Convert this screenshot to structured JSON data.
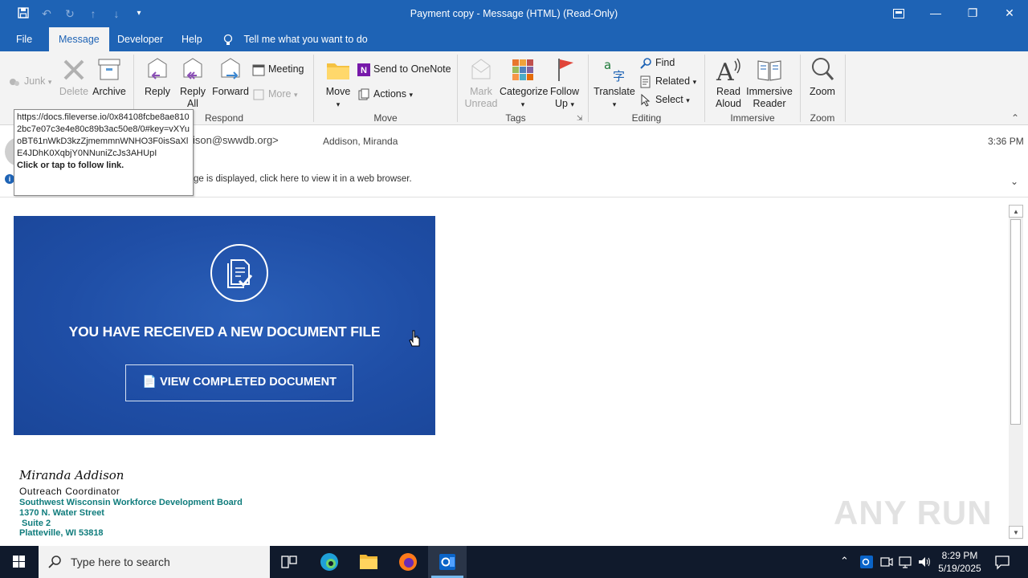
{
  "window": {
    "title": "Payment copy  -  Message (HTML) (Read-Only)"
  },
  "tabs": [
    {
      "label": "File"
    },
    {
      "label": "Message"
    },
    {
      "label": "Developer"
    },
    {
      "label": "Help"
    }
  ],
  "tell_me": "Tell me what you want to do",
  "ribbon": {
    "junk": "Junk",
    "delete": "Delete",
    "archive": "Archive",
    "reply": "Reply",
    "reply_all_1": "Reply",
    "reply_all_2": "All",
    "forward": "Forward",
    "meeting": "Meeting",
    "more": "More",
    "move": "Move",
    "send_onenote": "Send to OneNote",
    "actions": "Actions",
    "mark_unread_1": "Mark",
    "mark_unread_2": "Unread",
    "categorize": "Categorize",
    "follow_up_1": "Follow",
    "follow_up_2": "Up",
    "translate": "Translate",
    "find": "Find",
    "related": "Related",
    "select": "Select",
    "read_aloud_1": "Read",
    "read_aloud_2": "Aloud",
    "immersive_1": "Immersive",
    "immersive_2": "Reader",
    "zoom": "Zoom",
    "groups": {
      "respond": "Respond",
      "move": "Move",
      "tags": "Tags",
      "editing": "Editing",
      "immersive": "Immersive",
      "zoom": "Zoom"
    }
  },
  "header": {
    "from_partial": "ison@swwdb.org>",
    "to": "Addison, Miranda",
    "time": "3:36 PM",
    "info_partial": "ge is displayed, click here to view it in a web browser."
  },
  "tooltip": {
    "url": "https://docs.fileverse.io/0x84108fcbe8ae8102bc7e07c3e4e80c89b3ac50e8/0#key=vXYuoBT61nWkD3kzZjmemmnWNHO3F0isSaXlE4JDhK0XqbjY0NNuniZcJs3AHUpI",
    "hint": "Click or tap to follow link."
  },
  "banner": {
    "heading": "YOU HAVE RECEIVED A NEW DOCUMENT FILE",
    "button": "VIEW COMPLETED DOCUMENT",
    "accent": "#1f4ea6"
  },
  "signature": {
    "name": "Miranda Addison",
    "title": "Outreach Coordinator",
    "org": "Southwest Wisconsin Workforce Development Board",
    "street": "1370 N. Water Street",
    "suite": " Suite 2",
    "city": "Platteville, WI 53818"
  },
  "watermark": "ANY RUN",
  "taskbar": {
    "search_placeholder": "Type here to search",
    "time": "8:29 PM",
    "date": "5/19/2025"
  },
  "colors": {
    "titlebar": "#1e63b5",
    "ribbon": "#f3f3f3",
    "signature_org": "#0f7c7c"
  }
}
